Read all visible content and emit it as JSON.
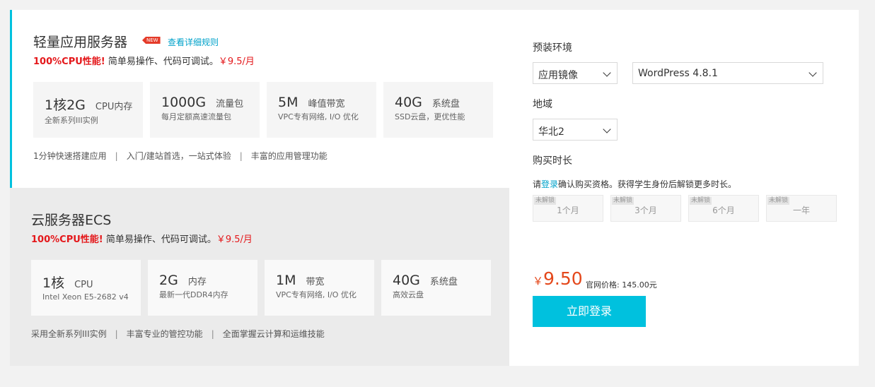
{
  "lightweight": {
    "title": "轻量应用服务器",
    "badge": "NEW",
    "rule_link": "查看详细规则",
    "promo_highlight": "100%CPU性能!",
    "promo_text": "简单易操作、代码可调试。",
    "promo_price": "￥9.5/月",
    "specs": [
      {
        "value": "1核2G",
        "unit": "CPU内存",
        "sub": "全新系列III实例"
      },
      {
        "value": "1000G",
        "unit": "流量包",
        "sub": "每月定额高速流量包"
      },
      {
        "value": "5M",
        "unit": "峰值带宽",
        "sub": "VPC专有网络, I/O 优化"
      },
      {
        "value": "40G",
        "unit": "系统盘",
        "sub": "SSD云盘，更优性能"
      }
    ],
    "features": [
      "1分钟快速搭建应用",
      "入门/建站首选，一站式体验",
      "丰富的应用管理功能"
    ],
    "separator": "|"
  },
  "ecs": {
    "title": "云服务器ECS",
    "promo_highlight": "100%CPU性能!",
    "promo_text": "简单易操作、代码可调试。",
    "promo_price": "￥9.5/月",
    "specs": [
      {
        "value": "1核",
        "unit": "CPU",
        "sub": "Intel Xeon E5-2682 v4"
      },
      {
        "value": "2G",
        "unit": "内存",
        "sub": "最新一代DDR4内存"
      },
      {
        "value": "1M",
        "unit": "带宽",
        "sub": "VPC专有网络, I/O 优化"
      },
      {
        "value": "40G",
        "unit": "系统盘",
        "sub": "高效云盘"
      }
    ],
    "features": [
      "采用全新系列III实例",
      "丰富专业的管控功能",
      "全面掌握云计算和运维技能"
    ],
    "separator": "|"
  },
  "config": {
    "env_label": "预装环境",
    "env_type": "应用镜像",
    "env_image": "WordPress 4.8.1",
    "region_label": "地域",
    "region_value": "华北2",
    "duration_label": "购买时长",
    "notice_pre": "请",
    "notice_link": "登录",
    "notice_post": "确认购买资格。获得学生身份后解锁更多时长。",
    "lock_text": "未解锁",
    "durations": [
      "1个月",
      "3个月",
      "6个月",
      "一年"
    ],
    "price_currency": "￥",
    "price_value": "9.50",
    "official_price": "官网价格: 145.00元",
    "login_button": "立即登录"
  }
}
